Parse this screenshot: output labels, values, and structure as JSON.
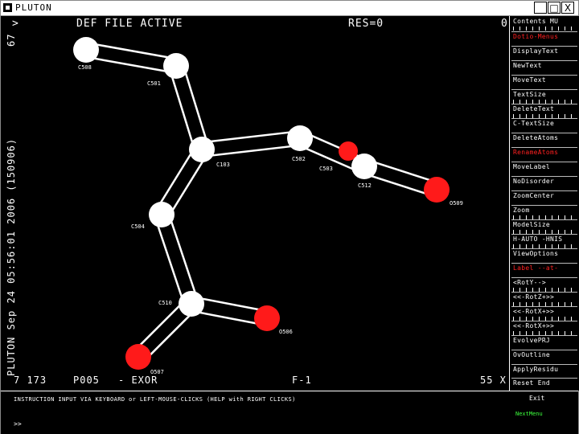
{
  "window": {
    "title": "PLUTON",
    "buttons": [
      "_",
      "□",
      "X"
    ]
  },
  "header": {
    "left_marker": ">",
    "status": "DEF FILE ACTIVE",
    "res": "RES=0",
    "right_marker": "0"
  },
  "side_info": "PLUTON Sep 24 05:56:01 2006 (150906)",
  "side_top": "67",
  "footer": {
    "left": "7 173",
    "space": "P005",
    "mode": "- EXOR",
    "center": "F-1",
    "right": "55 X"
  },
  "menu": {
    "items": [
      {
        "label": "Contents MU",
        "color": "white"
      },
      {
        "label": "Dotio-Menus",
        "color": "red"
      },
      {
        "label": "DisplayText",
        "color": "white"
      },
      {
        "label": "NewText",
        "color": "white"
      },
      {
        "label": "MoveText",
        "color": "white"
      },
      {
        "label": "TextSize",
        "color": "white"
      },
      {
        "label": "DeleteText",
        "color": "white"
      },
      {
        "label": "C-TextSize",
        "color": "white"
      },
      {
        "label": "DeleteAtoms",
        "color": "white"
      },
      {
        "label": "RenameAtoms",
        "color": "red"
      },
      {
        "label": "MoveLabel",
        "color": "white"
      },
      {
        "label": "NoDisorder",
        "color": "white"
      },
      {
        "label": "ZoomCenter",
        "color": "white"
      },
      {
        "label": "Zoom",
        "color": "white"
      },
      {
        "label": "ModelSize",
        "color": "white"
      },
      {
        "label": "H-AUTO  -HNIS",
        "color": "white"
      },
      {
        "label": "ViewOptions",
        "color": "white"
      },
      {
        "label": "Label  --at-",
        "color": "red"
      },
      {
        "label": "<RotY-->",
        "color": "white"
      },
      {
        "label": "<<-RotZ+>>",
        "color": "white"
      },
      {
        "label": "<<-RotX+>>",
        "color": "white"
      },
      {
        "label": "<<-RotX+>>",
        "color": "white"
      },
      {
        "label": "EvolvePRJ",
        "color": "white"
      },
      {
        "label": "OvOutline",
        "color": "white"
      },
      {
        "label": "ApplyResidu",
        "color": "white"
      },
      {
        "label": "Reset   End",
        "color": "white"
      }
    ]
  },
  "status_bar": {
    "instruction": "INSTRUCTION INPUT VIA KEYBOARD or LEFT-MOUSE-CLICKS (HELP with RIGHT CLICKS)",
    "exit": "Exit",
    "next": "NextMenu",
    "prompt": ">>"
  },
  "molecule": {
    "atoms": [
      {
        "id": "C508",
        "label": "C508",
        "element": "C"
      },
      {
        "id": "C501",
        "label": "C501",
        "element": "C"
      },
      {
        "id": "C103",
        "label": "C103",
        "element": "C"
      },
      {
        "id": "C502",
        "label": "C502",
        "element": "C"
      },
      {
        "id": "C503",
        "label": "C503",
        "element": "C"
      },
      {
        "id": "C512",
        "label": "C512",
        "element": "C"
      },
      {
        "id": "O509",
        "label": "O509",
        "element": "O"
      },
      {
        "id": "C504",
        "label": "C504",
        "element": "C"
      },
      {
        "id": "C510",
        "label": "C510",
        "element": "C"
      },
      {
        "id": "O506",
        "label": "O506",
        "element": "O"
      },
      {
        "id": "O507",
        "label": "O507",
        "element": "O"
      }
    ],
    "bonds": [
      [
        "C508",
        "C501"
      ],
      [
        "C501",
        "C103"
      ],
      [
        "C103",
        "C502"
      ],
      [
        "C502",
        "C512"
      ],
      [
        "C512",
        "O509"
      ],
      [
        "C103",
        "C504"
      ],
      [
        "C504",
        "C510"
      ],
      [
        "C510",
        "O506"
      ],
      [
        "C510",
        "O507"
      ]
    ],
    "colors": {
      "C": "#ffffff",
      "O": "#ff1a1a",
      "background": "#000000"
    }
  }
}
